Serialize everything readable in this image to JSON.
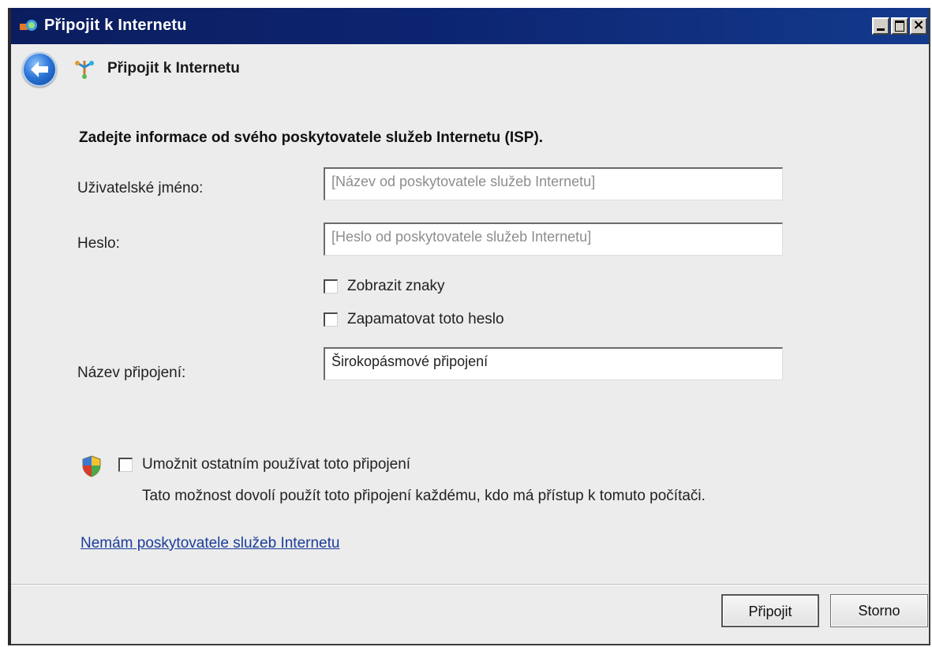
{
  "window": {
    "title": "Připojit k Internetu"
  },
  "nav": {
    "title": "Připojit k Internetu"
  },
  "form": {
    "heading": "Zadejte informace od svého poskytovatele služeb Internetu (ISP).",
    "username_label": "Uživatelské jméno:",
    "username_placeholder": "[Název od poskytovatele služeb Internetu]",
    "username_value": "",
    "password_label": "Heslo:",
    "password_placeholder": "[Heslo od poskytovatele služeb Internetu]",
    "password_value": "",
    "show_chars_label": "Zobrazit znaky",
    "show_chars_checked": false,
    "remember_label": "Zapamatovat toto heslo",
    "remember_checked": false,
    "connection_name_label": "Název připojení:",
    "connection_name_value": "Širokopásmové připojení",
    "allow_others_label": "Umožnit ostatním používat toto připojení",
    "allow_others_checked": false,
    "allow_others_desc": "Tato možnost dovolí použít toto připojení každému, kdo má přístup k tomuto počítači.",
    "no_isp_link": "Nemám poskytovatele služeb Internetu"
  },
  "buttons": {
    "connect": "Připojit",
    "cancel": "Storno"
  },
  "icons": {
    "title_icon": "network-connection-icon",
    "back": "back-arrow-icon",
    "nav_icon": "network-connection-icon",
    "shield": "uac-shield-icon"
  },
  "colors": {
    "titlebar": "#0c2470",
    "background": "#ececec",
    "link": "#1a3d9a"
  }
}
